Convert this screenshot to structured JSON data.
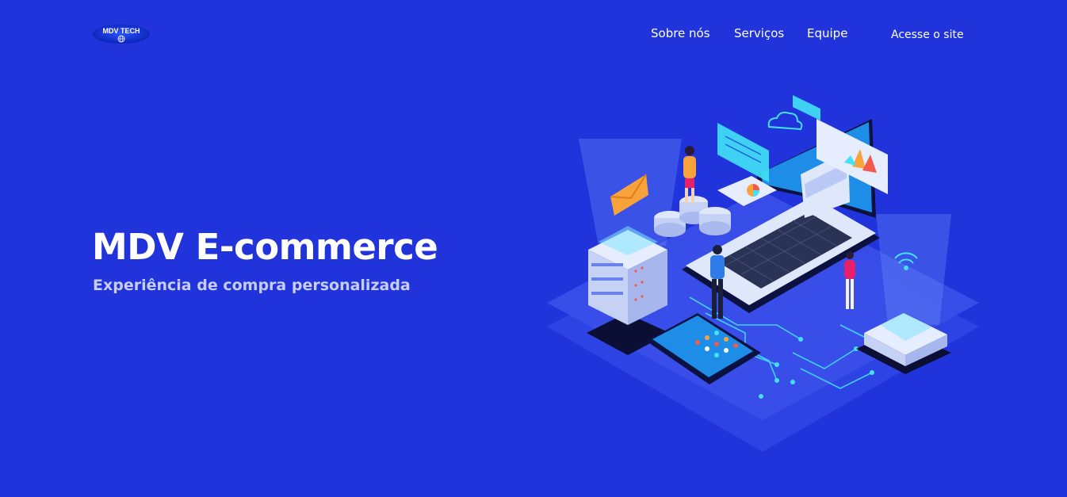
{
  "header": {
    "logo_text": "MDV TECH",
    "nav": [
      {
        "label": "Sobre nós"
      },
      {
        "label": "Serviços"
      },
      {
        "label": "Equipe"
      }
    ],
    "cta_label": "Acesse o site"
  },
  "hero": {
    "title": "MDV E-commerce",
    "subtitle": "Experiência de compra personalizada"
  },
  "colors": {
    "background": "#2134db",
    "subtitle": "#c7cdf6",
    "accent_cyan": "#41e2f5",
    "accent_orange": "#f7a23b"
  },
  "icons": [
    "globe-icon",
    "cloud-icon",
    "mail-icon",
    "wifi-icon",
    "pie-chart-icon"
  ]
}
